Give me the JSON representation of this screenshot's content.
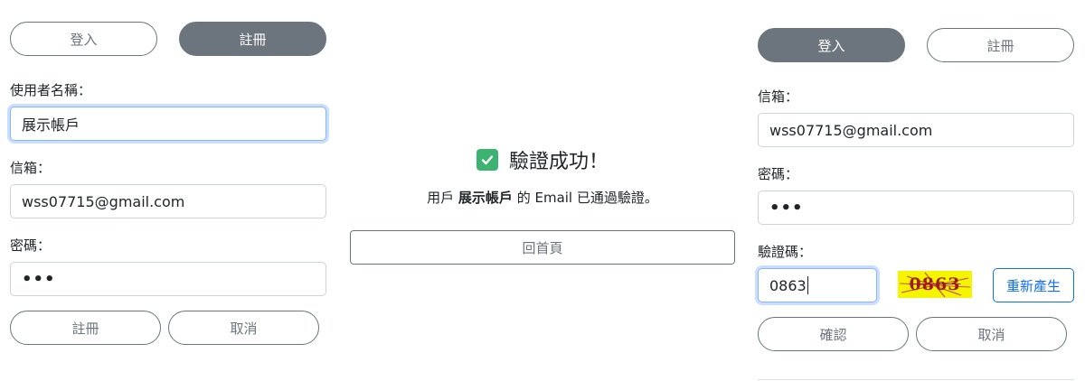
{
  "register_panel": {
    "login_tab": "登入",
    "register_tab": "註冊",
    "username_label": "使用者名稱：",
    "username_value": "展示帳戶",
    "email_label": "信箱：",
    "email_value": "wss07715@gmail.com",
    "password_label": "密碼：",
    "password_value": "•••",
    "submit_label": "註冊",
    "cancel_label": "取消"
  },
  "verify_panel": {
    "title": "驗證成功！",
    "message_prefix": "用戶",
    "message_user": "展示帳戶",
    "message_suffix": "的 Email 已通過驗證。",
    "home_button": "回首頁"
  },
  "login_panel": {
    "login_tab": "登入",
    "register_tab": "註冊",
    "email_label": "信箱：",
    "email_value": "wss07715@gmail.com",
    "password_label": "密碼：",
    "password_value": "•••",
    "captcha_label": "驗證碼：",
    "captcha_input_value": "0863",
    "captcha_image_text": "0863",
    "regenerate_label": "重新產生",
    "confirm_label": "確認",
    "cancel_label": "取消"
  },
  "colors": {
    "secondary": "#6c757d",
    "primary": "#0d6efd",
    "success": "#3cb371",
    "captcha_bg": "#f5f500",
    "captcha_text": "#a01c1c"
  },
  "icons": {
    "success": "check-mark-icon"
  }
}
